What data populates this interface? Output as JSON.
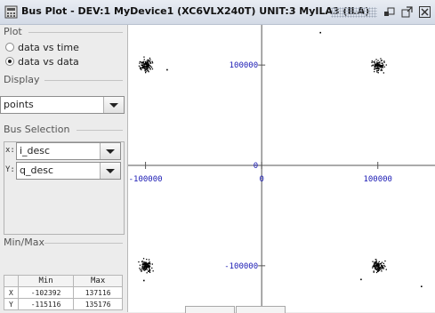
{
  "window": {
    "title": "Bus Plot - DEV:1 MyDevice1 (XC6VLX240T) UNIT:3 MyILA3 (ILA)"
  },
  "plot_section": {
    "header": "Plot",
    "options": [
      {
        "label": "data vs time",
        "selected": false
      },
      {
        "label": "data vs data",
        "selected": true
      }
    ]
  },
  "display_section": {
    "header": "Display",
    "mode": "points"
  },
  "bus_section": {
    "header": "Bus Selection",
    "x_label": "x:",
    "x_value": "i_desc",
    "y_label": "Y:",
    "y_value": "q_desc"
  },
  "minmax_section": {
    "header": "Min/Max",
    "columns": [
      "",
      "Min",
      "Max"
    ],
    "rows": [
      {
        "axis": "X",
        "min": "-102392",
        "max": "137116"
      },
      {
        "axis": "Y",
        "min": "-115116",
        "max": "135176"
      }
    ]
  },
  "chart_data": {
    "type": "scatter",
    "title": "",
    "xlabel": "",
    "ylabel": "",
    "xlim": [
      -115000,
      150000
    ],
    "ylim": [
      -140000,
      140000
    ],
    "x_tick_labels": [
      "-100000",
      "0",
      "100000"
    ],
    "y_tick_labels": [
      "100000",
      "0",
      "-100000"
    ],
    "clusters": [
      {
        "x": -100000,
        "y": 100000
      },
      {
        "x": 100000,
        "y": 100000
      },
      {
        "x": -100000,
        "y": -100000
      },
      {
        "x": 100000,
        "y": -100000
      }
    ],
    "outliers": [
      {
        "x": 50000,
        "y": 133000
      },
      {
        "x": -82000,
        "y": 96000
      },
      {
        "x": 85000,
        "y": -113000
      },
      {
        "x": 137000,
        "y": -120000
      },
      {
        "x": -102000,
        "y": -114000
      }
    ],
    "colors": {
      "points": "#000000",
      "axes": "#555555",
      "labels": "#1a1ab4"
    }
  }
}
